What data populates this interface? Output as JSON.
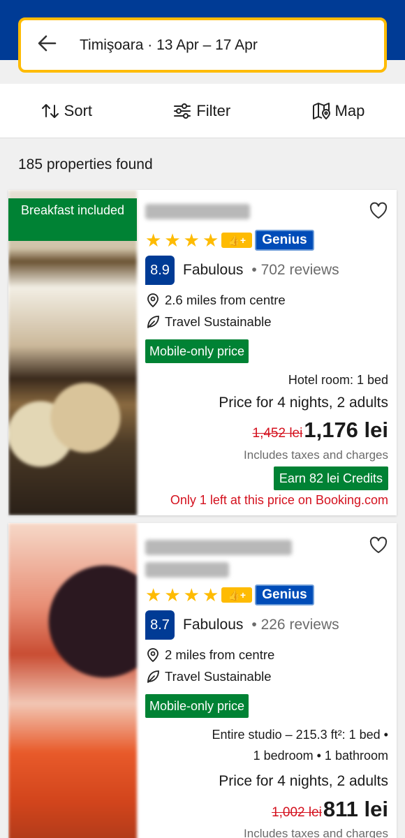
{
  "search": {
    "query": "Timişoara · 13 Apr – 17 Apr"
  },
  "toolbar": {
    "sort_label": "Sort",
    "filter_label": "Filter",
    "map_label": "Map"
  },
  "results": {
    "count_text": "185 properties found"
  },
  "colors": {
    "brand_blue": "#003b95",
    "search_border": "#febb02",
    "deal_green": "#008234",
    "alert_red": "#d4111e"
  },
  "listings": [
    {
      "badge": "Breakfast included",
      "genius_label": "Genius",
      "stars": 4,
      "score": "8.9",
      "score_word": "Fabulous",
      "reviews": "• 702 reviews",
      "distance": "2.6 miles from centre",
      "sustainable": "Travel Sustainable",
      "mobile_price": "Mobile-only price",
      "room": "Hotel room: 1 bed",
      "stay": "Price for 4 nights, 2 adults",
      "old_price": "1,452 lei",
      "price": "1,176 lei",
      "taxes": "Includes taxes and charges",
      "credits": "Earn 82 lei Credits",
      "scarcity": "Only 1 left at this price on Booking.com"
    },
    {
      "genius_label": "Genius",
      "stars": 4,
      "score": "8.7",
      "score_word": "Fabulous",
      "reviews": "• 226 reviews",
      "distance": "2 miles from centre",
      "sustainable": "Travel Sustainable",
      "mobile_price": "Mobile-only price",
      "room_line1": "Entire studio – 215.3 ft²: 1 bed •",
      "room_line2": "1 bedroom • 1 bathroom",
      "stay": "Price for 4 nights, 2 adults",
      "old_price": "1,002 lei",
      "price": "811 lei",
      "taxes": "Includes taxes and charges"
    }
  ]
}
